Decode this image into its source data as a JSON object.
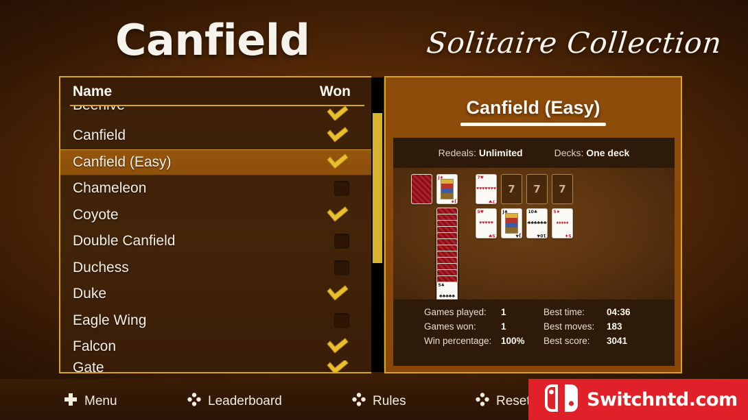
{
  "header": {
    "title": "Canfield",
    "subtitle": "Solitaire Collection"
  },
  "list": {
    "col_name": "Name",
    "col_won": "Won",
    "rows": [
      {
        "label": "Beehive",
        "won": true,
        "clip": "top"
      },
      {
        "label": "Canfield",
        "won": true,
        "clip": ""
      },
      {
        "label": "Canfield (Easy)",
        "won": true,
        "clip": "",
        "selected": true
      },
      {
        "label": "Chameleon",
        "won": false,
        "clip": ""
      },
      {
        "label": "Coyote",
        "won": true,
        "clip": ""
      },
      {
        "label": "Double Canfield",
        "won": false,
        "clip": ""
      },
      {
        "label": "Duchess",
        "won": false,
        "clip": ""
      },
      {
        "label": "Duke",
        "won": true,
        "clip": ""
      },
      {
        "label": "Eagle Wing",
        "won": false,
        "clip": ""
      },
      {
        "label": "Falcon",
        "won": true,
        "clip": ""
      },
      {
        "label": "Gate",
        "won": true,
        "clip": "bottom"
      }
    ]
  },
  "detail": {
    "title": "Canfield (Easy)",
    "redeals_label": "Redeals:",
    "redeals_value": "Unlimited",
    "decks_label": "Decks:",
    "decks_value": "One deck",
    "stats": [
      {
        "label": "Games played:",
        "value": "1",
        "label2": "Best time:",
        "value2": "04:36"
      },
      {
        "label": "Games won:",
        "value": "1",
        "label2": "Best moves:",
        "value2": "183"
      },
      {
        "label": "Win percentage:",
        "value": "100%",
        "label2": "Best score:",
        "value2": "3041"
      }
    ],
    "board": {
      "stock": {
        "type": "back"
      },
      "waste": {
        "type": "court",
        "rank": "J",
        "suit": "♦",
        "color": "red"
      },
      "foundations": [
        {
          "type": "card",
          "rank": "7",
          "suit": "♥",
          "color": "red",
          "pips": 7
        },
        {
          "type": "empty",
          "text": "7"
        },
        {
          "type": "empty",
          "text": "7"
        },
        {
          "type": "empty",
          "text": "7"
        }
      ],
      "tableau": [
        {
          "type": "card",
          "rank": "5",
          "suit": "♥",
          "color": "red",
          "pips": 5
        },
        {
          "type": "court",
          "rank": "J",
          "suit": "♣",
          "color": "black"
        },
        {
          "type": "card",
          "rank": "10",
          "suit": "♣",
          "color": "black",
          "pips": 10
        },
        {
          "type": "card",
          "rank": "5",
          "suit": "♦",
          "color": "red",
          "pips": 5
        }
      ],
      "reserve_back_count": 12,
      "reserve_bottom": {
        "type": "card",
        "rank": "5",
        "suit": "♣",
        "color": "black",
        "pips": 5
      }
    }
  },
  "toolbar": {
    "items": [
      {
        "label": "Menu",
        "icon": "plus-pad-icon"
      },
      {
        "label": "Leaderboard",
        "icon": "four-dot-icon"
      },
      {
        "label": "Rules",
        "icon": "four-dot-icon"
      },
      {
        "label": "Reset s",
        "icon": "four-dot-icon"
      }
    ]
  },
  "watermark": {
    "text": "Switchntd.com"
  },
  "colors": {
    "gold": "#d8a521",
    "panel_brown": "#8e4c0a",
    "list_brown": "#3d2009",
    "selected_row": "#96550c",
    "watermark_red": "#e02129"
  }
}
